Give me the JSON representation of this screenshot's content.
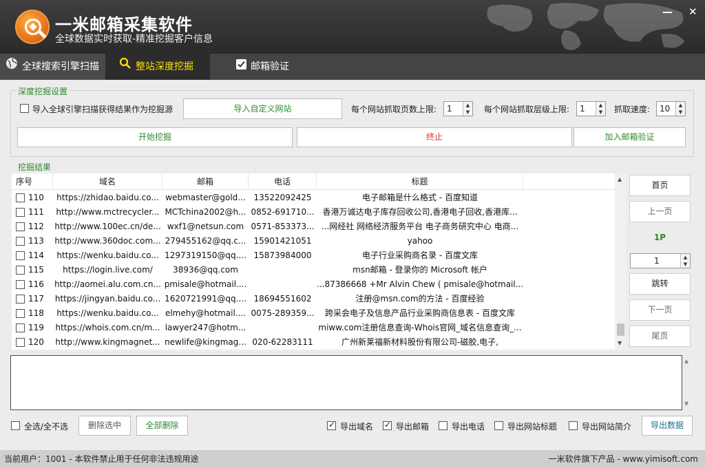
{
  "header": {
    "title": "一米邮箱采集软件",
    "subtitle": "全球数据实时获取-精准挖掘客户信息",
    "minimize": "—",
    "close": "✕"
  },
  "tabs": [
    {
      "label": "全球搜索引擎扫描",
      "icon": "globe-icon"
    },
    {
      "label": "整站深度挖掘",
      "icon": "search-icon"
    },
    {
      "label": "邮箱验证",
      "icon": "checkbox-icon"
    }
  ],
  "settings": {
    "group_title": "深度挖掘设置",
    "import_global_label": "导入全球引擎扫描获得结果作为挖掘源",
    "import_custom_button": "导入自定义网站",
    "pages_limit_label": "每个网站抓取页数上限:",
    "pages_limit_value": "1",
    "depth_limit_label": "每个网站抓取层级上限:",
    "depth_limit_value": "1",
    "speed_label": "抓取速度:",
    "speed_value": "10",
    "start_button": "开始挖掘",
    "stop_button": "终止",
    "add_verify_button": "加入邮箱验证"
  },
  "results": {
    "group_title": "挖掘结果",
    "columns": [
      "序号",
      "域名",
      "邮箱",
      "电话",
      "标题"
    ],
    "rows": [
      {
        "idx": "110",
        "domain": "https://zhidao.baidu.co...",
        "email": "webmaster@gold...",
        "phone": "13522092425",
        "title": "电子邮箱是什么格式 - 百度知道"
      },
      {
        "idx": "111",
        "domain": "http://www.mctrecycler...",
        "email": "MCTchina2002@h...",
        "phone": "0852-691710...",
        "title": "香港万诚达电子库存回收公司,香港电子回收,香港库..."
      },
      {
        "idx": "112",
        "domain": "http://www.100ec.cn/de...",
        "email": "wxf1@netsun.com",
        "phone": "0571-853373...",
        "title": "...网经社 网络经济服务平台 电子商务研究中心 电商..."
      },
      {
        "idx": "113",
        "domain": "http://www.360doc.com...",
        "email": "279455162@qq.c...",
        "phone": "15901421051",
        "title": "yahoo"
      },
      {
        "idx": "114",
        "domain": "https://wenku.baidu.co...",
        "email": "1297319150@qq....",
        "phone": "15873984000",
        "title": "电子行业采购商名录 - 百度文库"
      },
      {
        "idx": "115",
        "domain": "https://login.live.com/",
        "email": "38936@qq.com",
        "phone": "",
        "title": "msn邮箱 - 登录你的 Microsoft 帐户"
      },
      {
        "idx": "116",
        "domain": "http://aomei.alu.com.cn...",
        "email": "pmisale@hotmail....",
        "phone": "",
        "title": "...87386668 +Mr Alvin Chew ( pmisale@hotmail...."
      },
      {
        "idx": "117",
        "domain": "https://jingyan.baidu.co...",
        "email": "1620721991@qq....",
        "phone": "18694551602",
        "title": "注册@msn.com的方法 - 百度经验"
      },
      {
        "idx": "118",
        "domain": "https://wenku.baidu.co...",
        "email": "elmehy@hotmail....",
        "phone": "0075-289359...",
        "title": "跨采会电子及信息产品行业采购商信息表 - 百度文库"
      },
      {
        "idx": "119",
        "domain": "https://whois.com.cn/m...",
        "email": "lawyer247@hotm...",
        "phone": "",
        "title": "miww.com注册信息查询-Whois官网_域名信息查询_..."
      },
      {
        "idx": "120",
        "domain": "http://www.kingmagnet...",
        "email": "newlife@kingmag...",
        "phone": "020-62283111",
        "title": "广州新莱福新材料股份有限公司-磁胶,电子,"
      }
    ]
  },
  "pager": {
    "first": "首页",
    "prev": "上一页",
    "current": "1P",
    "page_input": "1",
    "jump": "跳转",
    "next": "下一页",
    "last": "尾页"
  },
  "bottom": {
    "select_all": "全选/全不选",
    "delete_selected": "删除选中",
    "delete_all": "全部删除",
    "export_domain": "导出域名",
    "export_email": "导出邮箱",
    "export_phone": "导出电话",
    "export_title": "导出网站标题",
    "export_intro": "导出网站简介",
    "export_button": "导出数据"
  },
  "footer": {
    "left": "当前用户：1001 - 本软件禁止用于任何非法违规用途",
    "right": "一米软件旗下产品 - www.yimisoft.com"
  },
  "colors": {
    "accent_green": "#2e8b2e",
    "stop_red": "#e03030",
    "tab_active": "#ffe000"
  }
}
